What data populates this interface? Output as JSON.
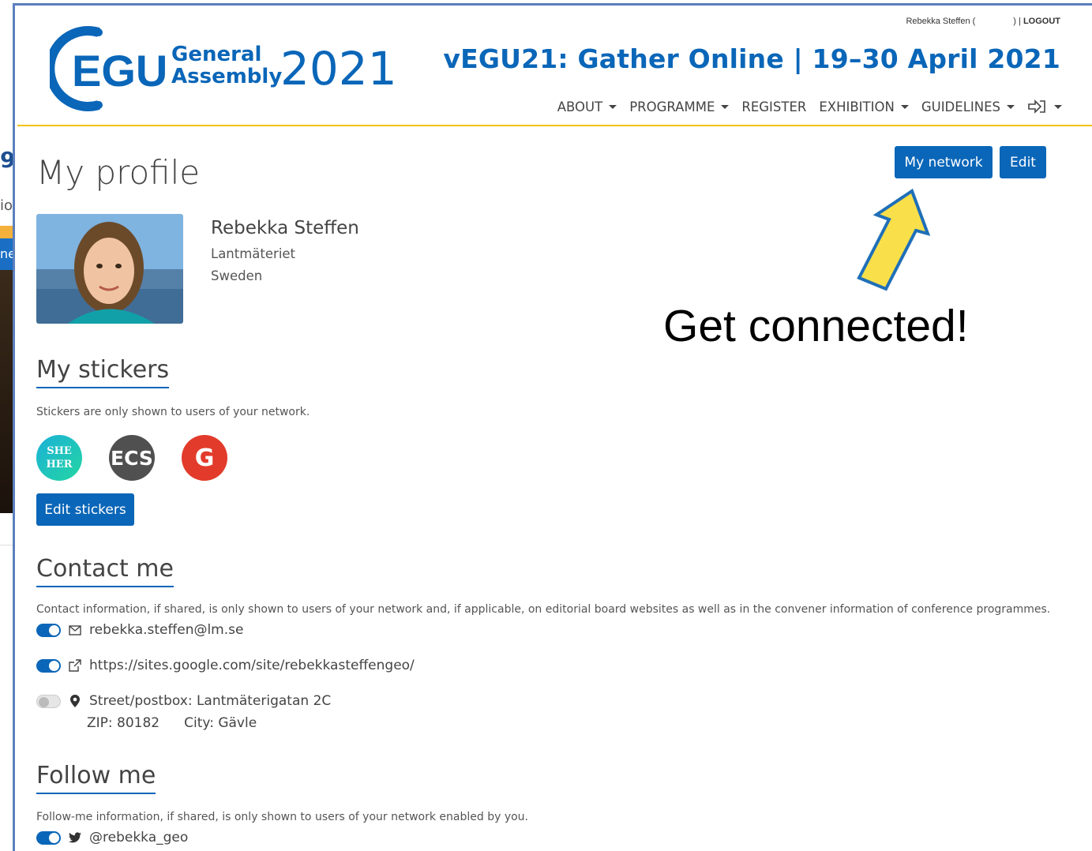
{
  "background_window": {
    "number_fragment": "9",
    "text_fragment": "io",
    "button_fragment": "ne"
  },
  "header": {
    "user_name": "Rebekka Steffen (",
    "user_suffix": ") |",
    "logout": "LOGOUT",
    "logo": {
      "abbr": "EGU",
      "line1": "General",
      "line2": "Assembly",
      "year": "2021"
    },
    "event_title": "vEGU21: Gather Online | 19–30 April 2021",
    "nav": [
      {
        "label": "ABOUT"
      },
      {
        "label": "PROGRAMME"
      },
      {
        "label": "REGISTER"
      },
      {
        "label": "EXHIBITION"
      },
      {
        "label": "GUIDELINES"
      }
    ],
    "signin_icon": "sign-in-icon",
    "colors": {
      "brand": "#0a66b8",
      "accent_rule": "#f4c20d"
    }
  },
  "page": {
    "title": "My profile",
    "buttons": {
      "network": "My network",
      "edit": "Edit"
    }
  },
  "profile": {
    "name": "Rebekka Steffen",
    "organization": "Lantmäteriet",
    "country": "Sweden"
  },
  "stickers": {
    "heading": "My stickers",
    "note": "Stickers are only shown to users of your network.",
    "items": [
      {
        "line1": "SHE",
        "line2": "HER"
      },
      {
        "label": "ECS"
      },
      {
        "label": "G"
      }
    ],
    "edit_button": "Edit stickers"
  },
  "contact": {
    "heading": "Contact me",
    "note": "Contact information, if shared, is only shown to users of your network and, if applicable, on editorial board websites as well as in the convener information of conference programmes.",
    "email": {
      "value": "rebekka.steffen@lm.se",
      "shared": true,
      "icon": "envelope-icon"
    },
    "website": {
      "value": "https://sites.google.com/site/rebekkasteffengeo/",
      "shared": true,
      "icon": "external-link-icon"
    },
    "address": {
      "street": "Street/postbox: Lantmäterigatan 2C",
      "zip": "ZIP: 80182",
      "city": "City: Gävle",
      "shared": false,
      "icon": "map-marker-icon"
    }
  },
  "follow": {
    "heading": "Follow me",
    "note": "Follow-me information, if shared, is only shown to users of your network enabled by you.",
    "twitter": {
      "value": "@rebekka_geo",
      "shared": true,
      "icon": "twitter-icon"
    }
  },
  "annotation": {
    "text": "Get connected!",
    "arrow_color": "#f9e04b",
    "arrow_outline": "#1f6fb8"
  }
}
